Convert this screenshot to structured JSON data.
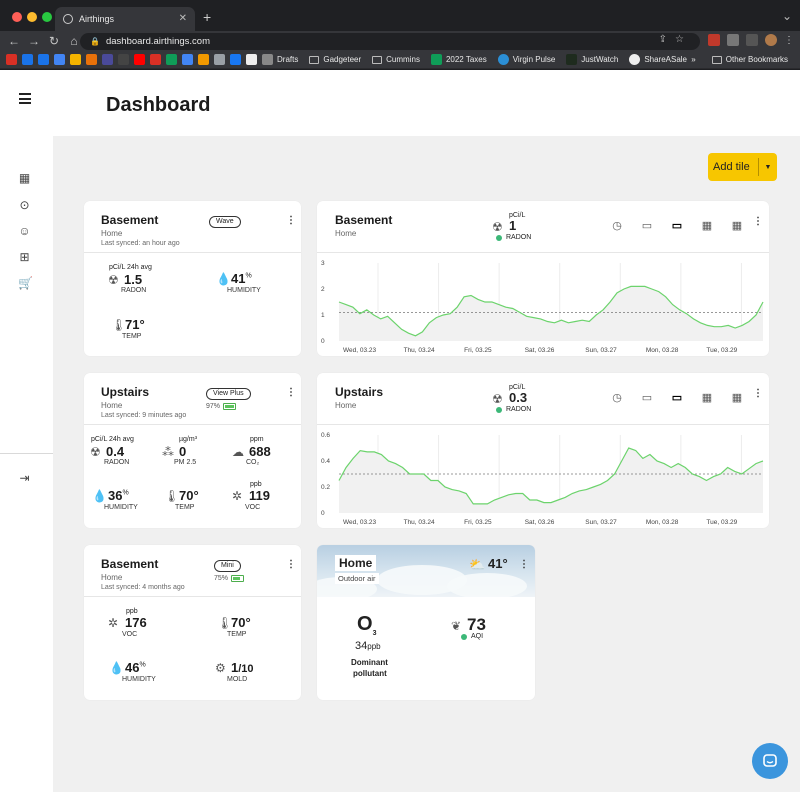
{
  "browser": {
    "tab_title": "Airthings",
    "url": "dashboard.airthings.com",
    "bookmarks": [
      "Drafts",
      "Gadgeteer",
      "Cummins",
      "2022 Taxes",
      "Virgin Pulse",
      "JustWatch",
      "ShareASale"
    ],
    "other_bookmarks": "Other Bookmarks",
    "overflow": "»"
  },
  "page": {
    "title": "Dashboard",
    "add_tile": "Add tile"
  },
  "colors": {
    "accent": "#f7c600",
    "chart_line": "#6cd36c",
    "status_good": "#3cb878",
    "chat": "#3b95dd"
  },
  "tiles": {
    "basement_wave": {
      "title": "Basement",
      "location": "Home",
      "synced": "Last synced: an hour ago",
      "device": "Wave",
      "radon": {
        "unit": "pCi/L 24h avg",
        "value": "1.5",
        "label": "RADON"
      },
      "humidity": {
        "value": "41",
        "unit": "%",
        "label": "HUMIDITY"
      },
      "temp": {
        "value": "71°",
        "label": "TEMP"
      }
    },
    "upstairs": {
      "title": "Upstairs",
      "location": "Home",
      "synced": "Last synced: 9 minutes ago",
      "device": "View Plus",
      "battery": "97%",
      "battery_level": 0.97,
      "radon": {
        "unit": "pCi/L 24h avg",
        "value": "0.4",
        "label": "RADON"
      },
      "pm": {
        "unit": "µg/m³",
        "value": "0",
        "label": "PM 2.5"
      },
      "co2": {
        "unit": "ppm",
        "value": "688",
        "label": "CO₂"
      },
      "humidity": {
        "value": "36",
        "unit": "%",
        "label": "HUMIDITY"
      },
      "temp": {
        "value": "70°",
        "label": "TEMP"
      },
      "voc": {
        "unit": "ppb",
        "value": "119",
        "label": "VOC"
      }
    },
    "basement_mini": {
      "title": "Basement",
      "location": "Home",
      "synced": "Last synced: 4 months ago",
      "device": "Mini",
      "battery": "75%",
      "battery_level": 0.75,
      "voc": {
        "unit": "ppb",
        "value": "176",
        "label": "VOC"
      },
      "temp": {
        "value": "70°",
        "label": "TEMP"
      },
      "humidity": {
        "value": "46",
        "unit": "%",
        "label": "HUMIDITY"
      },
      "mold": {
        "value": "1",
        "suffix": "/10",
        "label": "MOLD"
      }
    },
    "home_outdoor": {
      "title": "Home",
      "subtitle": "Outdoor air",
      "temp": "41°",
      "pollutant_symbol": "O",
      "pollutant_sub": "3",
      "pollutant_amount": "34",
      "pollutant_unit": "ppb",
      "pollutant_label_1": "Dominant",
      "pollutant_label_2": "pollutant",
      "aqi_value": "73",
      "aqi_label": "AQI"
    },
    "basement_chart": {
      "title": "Basement",
      "location": "Home",
      "unit": "pCi/L",
      "value": "1",
      "label": "RADON"
    },
    "upstairs_chart": {
      "title": "Upstairs",
      "location": "Home",
      "unit": "pCi/L",
      "value": "0.3",
      "label": "RADON"
    }
  },
  "chart_data": [
    {
      "type": "line",
      "title": "Basement",
      "x": [
        "Wed, 03.23",
        "Thu, 03.24",
        "Fri, 03.25",
        "Sat, 03.26",
        "Sun, 03.27",
        "Mon, 03.28",
        "Tue, 03.29"
      ],
      "ylim": [
        0,
        3
      ],
      "yticks": [
        "0",
        "1",
        "2",
        "3"
      ],
      "threshold": 1.1,
      "series": [
        {
          "values": [
            1.5,
            1.4,
            1.3,
            1.05,
            1.2,
            1.0,
            0.85,
            0.95,
            0.7,
            0.45,
            0.3,
            0.2,
            0.35,
            0.7,
            0.9,
            1.0,
            1.05,
            1.3,
            1.7,
            1.75,
            1.6,
            1.5,
            1.5,
            1.4,
            1.3,
            1.25,
            1.1,
            0.95,
            0.9,
            0.85,
            0.75,
            0.7,
            0.8,
            0.7,
            0.75,
            0.8,
            0.75,
            1.0,
            1.2,
            1.5,
            1.85,
            2.0,
            2.1,
            2.1,
            2.1,
            2.0,
            1.9,
            1.7,
            1.4,
            1.2,
            1.05,
            0.85,
            0.7,
            0.6,
            0.55,
            0.55,
            0.6,
            0.5,
            0.6,
            0.75,
            1.0,
            1.5
          ]
        }
      ]
    },
    {
      "type": "line",
      "title": "Upstairs",
      "x": [
        "Wed, 03.23",
        "Thu, 03.24",
        "Fri, 03.25",
        "Sat, 03.26",
        "Sun, 03.27",
        "Mon, 03.28",
        "Tue, 03.29"
      ],
      "ylim": [
        0,
        0.6
      ],
      "yticks": [
        "0",
        "0.2",
        "0.4",
        "0.6"
      ],
      "threshold": 0.3,
      "series": [
        {
          "values": [
            0.25,
            0.35,
            0.42,
            0.48,
            0.47,
            0.47,
            0.45,
            0.4,
            0.38,
            0.35,
            0.3,
            0.3,
            0.3,
            0.25,
            0.25,
            0.2,
            0.18,
            0.17,
            0.15,
            0.07,
            0.07,
            0.07,
            0.1,
            0.12,
            0.14,
            0.15,
            0.15,
            0.1,
            0.1,
            0.08,
            0.08,
            0.1,
            0.12,
            0.15,
            0.17,
            0.18,
            0.2,
            0.22,
            0.25,
            0.3,
            0.4,
            0.5,
            0.48,
            0.42,
            0.45,
            0.4,
            0.38,
            0.35,
            0.38,
            0.35,
            0.3,
            0.28,
            0.25,
            0.28,
            0.3,
            0.35,
            0.32,
            0.3,
            0.34,
            0.38,
            0.4
          ]
        }
      ]
    }
  ]
}
